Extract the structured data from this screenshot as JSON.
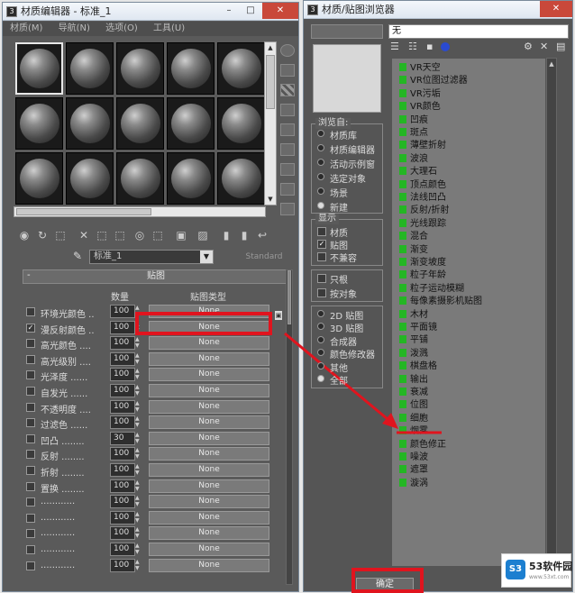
{
  "material_editor": {
    "title": "材质编辑器 - 标准_1",
    "menu": [
      "材质(M)",
      "导航(N)",
      "选项(O)",
      "工具(U)"
    ],
    "material_name": "标准_1",
    "material_type": "Standard",
    "rollout_title": "贴图",
    "col_amount": "数量",
    "col_map_type": "贴图类型",
    "rows": [
      {
        "label": "环境光颜色 ..",
        "checked": false,
        "amount": "100",
        "map": "None"
      },
      {
        "label": "漫反射颜色 ..",
        "checked": true,
        "amount": "100",
        "map": "None"
      },
      {
        "label": "高光颜色 ....",
        "checked": false,
        "amount": "100",
        "map": "None"
      },
      {
        "label": "高光级别 ....",
        "checked": false,
        "amount": "100",
        "map": "None"
      },
      {
        "label": "光泽度 ......",
        "checked": false,
        "amount": "100",
        "map": "None"
      },
      {
        "label": "自发光 ......",
        "checked": false,
        "amount": "100",
        "map": "None"
      },
      {
        "label": "不透明度 ....",
        "checked": false,
        "amount": "100",
        "map": "None"
      },
      {
        "label": "过滤色 ......",
        "checked": false,
        "amount": "100",
        "map": "None"
      },
      {
        "label": "凹凸 ........",
        "checked": false,
        "amount": "30",
        "map": "None"
      },
      {
        "label": "反射 ........",
        "checked": false,
        "amount": "100",
        "map": "None"
      },
      {
        "label": "折射 ........",
        "checked": false,
        "amount": "100",
        "map": "None"
      },
      {
        "label": "置换 ........",
        "checked": false,
        "amount": "100",
        "map": "None"
      },
      {
        "label": "............",
        "checked": false,
        "amount": "100",
        "map": "None"
      },
      {
        "label": "............",
        "checked": false,
        "amount": "100",
        "map": "None"
      },
      {
        "label": "............",
        "checked": false,
        "amount": "100",
        "map": "None"
      },
      {
        "label": "............",
        "checked": false,
        "amount": "100",
        "map": "None"
      },
      {
        "label": "............",
        "checked": false,
        "amount": "100",
        "map": "None"
      }
    ]
  },
  "browser": {
    "title": "材质/贴图浏览器",
    "search_value": "无",
    "browse_from_title": "浏览自:",
    "browse_from": [
      {
        "label": "材质库",
        "on": false
      },
      {
        "label": "材质编辑器",
        "on": false
      },
      {
        "label": "活动示例窗",
        "on": false
      },
      {
        "label": "选定对象",
        "on": false
      },
      {
        "label": "场景",
        "on": false
      },
      {
        "label": "新建",
        "on": true
      }
    ],
    "show_title": "显示",
    "show": [
      {
        "label": "材质",
        "checked": false
      },
      {
        "label": "贴图",
        "checked": true
      },
      {
        "label": "不兼容",
        "checked": false
      }
    ],
    "extra": [
      {
        "label": "只根",
        "checked": false
      },
      {
        "label": "按对象",
        "checked": false
      }
    ],
    "categories": [
      {
        "label": "2D 贴图",
        "on": false
      },
      {
        "label": "3D 贴图",
        "on": false
      },
      {
        "label": "合成器",
        "on": false
      },
      {
        "label": "颜色修改器",
        "on": false
      },
      {
        "label": "其他",
        "on": false
      },
      {
        "label": "全部",
        "on": true
      }
    ],
    "maps": [
      "VR天空",
      "VR位图过滤器",
      "VR污垢",
      "VR颜色",
      "凹痕",
      "斑点",
      "薄壁折射",
      "波浪",
      "大理石",
      "顶点颜色",
      "法线凹凸",
      "反射/折射",
      "光线跟踪",
      "混合",
      "渐变",
      "渐变坡度",
      "粒子年龄",
      "粒子运动模糊",
      "每像素摄影机贴图",
      "木材",
      "平面镜",
      "平铺",
      "泼溅",
      "棋盘格",
      "输出",
      "衰减",
      "位图",
      "细胞",
      "烟雾",
      "颜色修正",
      "噪波",
      "遮罩",
      "漩涡"
    ],
    "ok": "确定"
  },
  "watermark": {
    "brand": "53软件园",
    "url": "www.53xt.com"
  },
  "colors": {
    "accent_red": "#e0141e",
    "map_green": "#24b624"
  }
}
